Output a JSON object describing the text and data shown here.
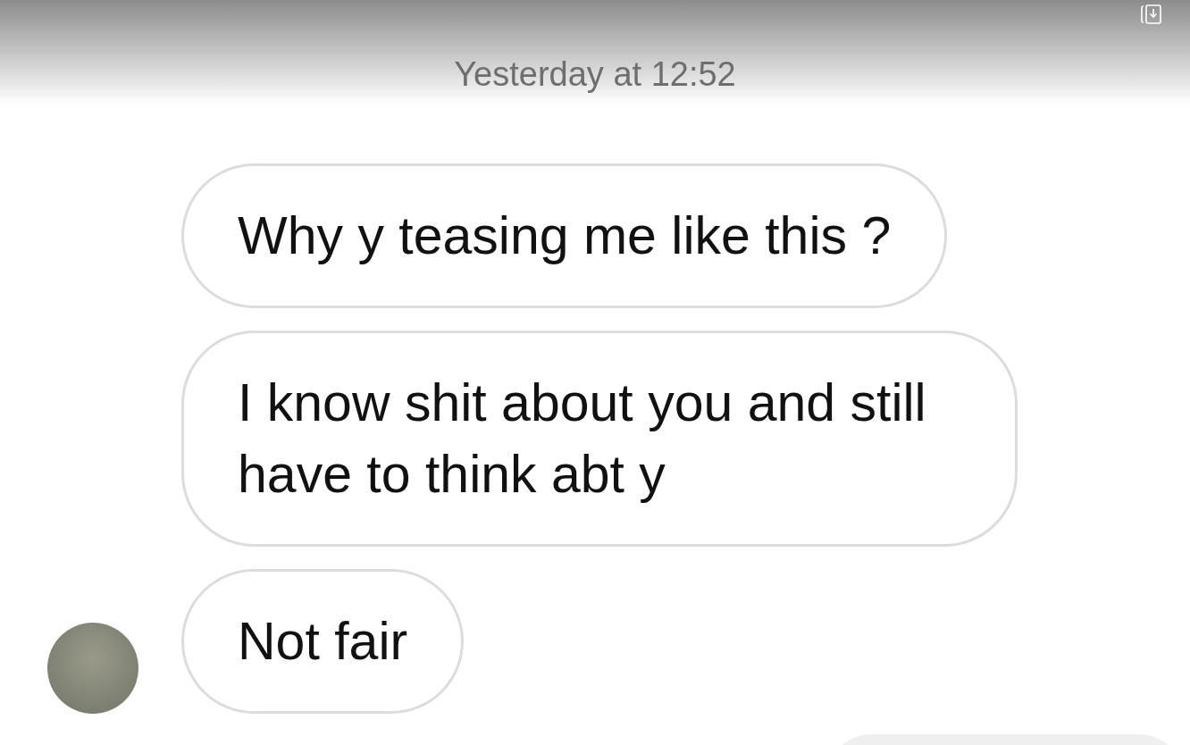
{
  "timestamp": "Yesterday at 12:52",
  "messages": [
    {
      "text": "Why y teasing me like this ?",
      "avatar": false
    },
    {
      "text": "I know shit about you and still have to think abt y",
      "avatar": false
    },
    {
      "text": "Not fair",
      "avatar": true
    }
  ]
}
